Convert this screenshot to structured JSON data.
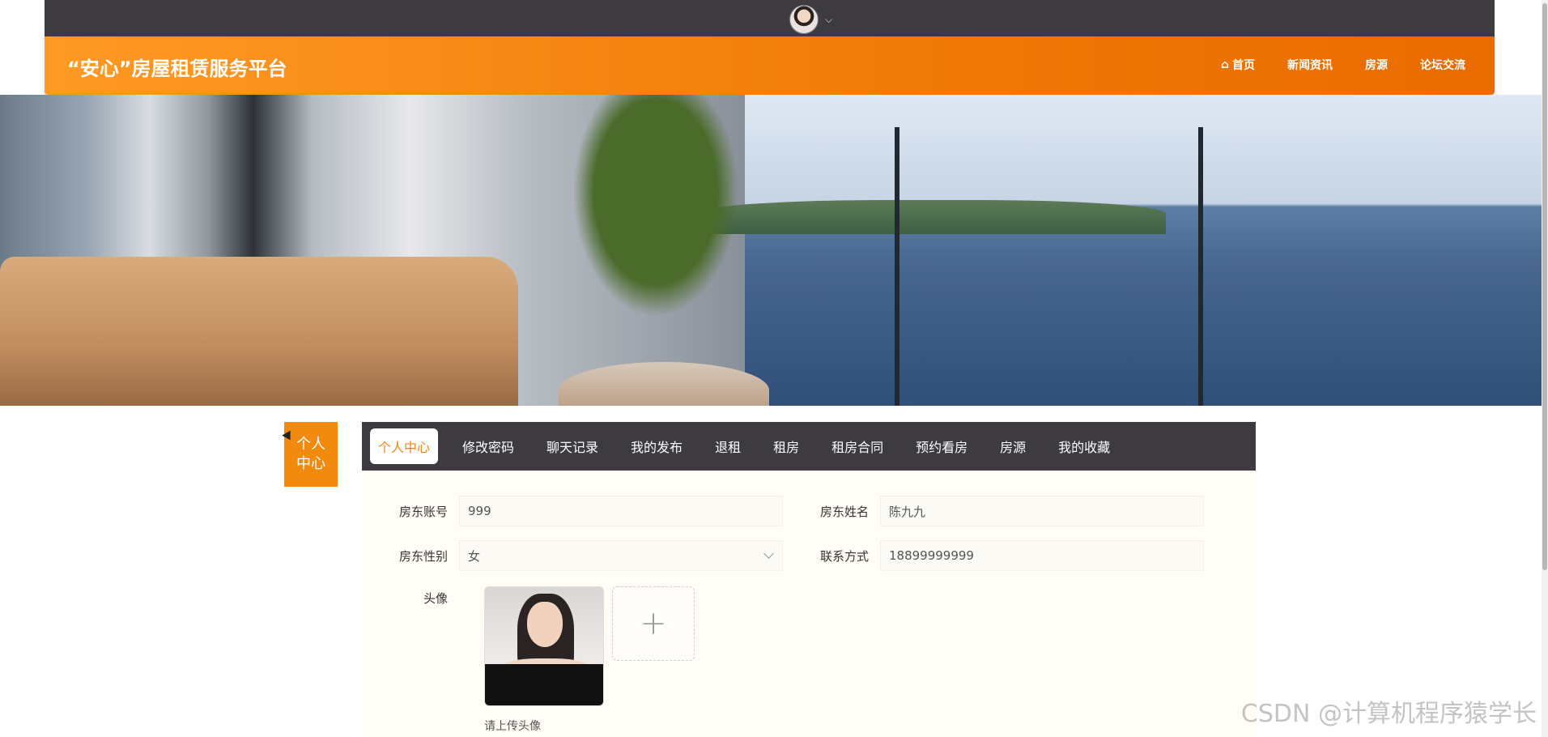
{
  "header": {
    "brand": "“安心”房屋租赁服务平台",
    "nav": [
      {
        "label": "首页",
        "icon": "home-icon"
      },
      {
        "label": "新闻资讯"
      },
      {
        "label": "房源"
      },
      {
        "label": "论坛交流"
      }
    ]
  },
  "sidebar": {
    "tag": "个人\n中心"
  },
  "tabs": [
    "个人中心",
    "修改密码",
    "聊天记录",
    "我的发布",
    "退租",
    "租房",
    "租房合同",
    "预约看房",
    "房源",
    "我的收藏"
  ],
  "form": {
    "account_label": "房东账号",
    "account_value": "999",
    "name_label": "房东姓名",
    "name_value": "陈九九",
    "gender_label": "房东性别",
    "gender_value": "女",
    "contact_label": "联系方式",
    "contact_value": "18899999999",
    "avatar_label": "头像",
    "upload_hint": "请上传头像"
  },
  "watermark": "CSDN @计算机程序猿学长",
  "colors": {
    "accent": "#f28a0f",
    "dark": "#3d3b3f"
  }
}
